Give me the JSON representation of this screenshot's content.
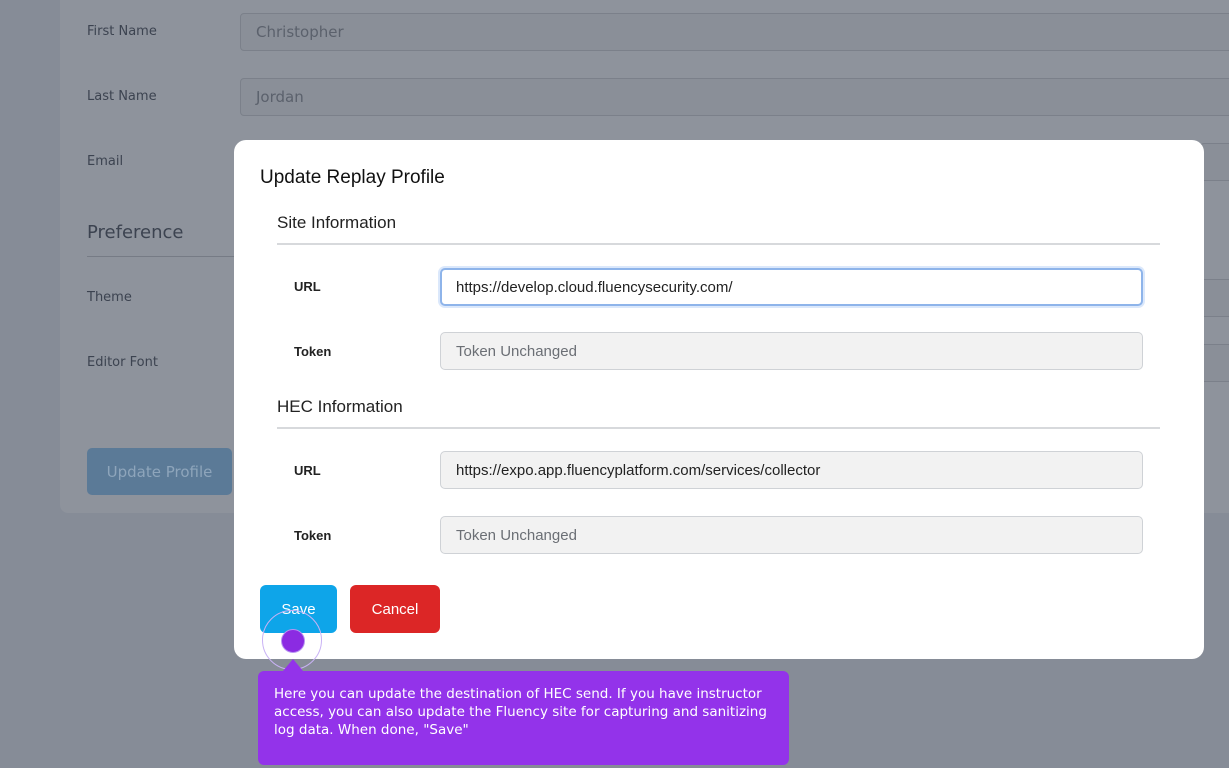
{
  "background_page": {
    "first_name_label": "First Name",
    "first_name_value": "Christopher",
    "last_name_label": "Last Name",
    "last_name_value": "Jordan",
    "email_label": "Email",
    "preference_heading": "Preference",
    "theme_label": "Theme",
    "editor_font_label": "Editor Font",
    "update_profile_button": "Update Profile"
  },
  "modal": {
    "title": "Update Replay Profile",
    "site_section": {
      "title": "Site Information",
      "url_label": "URL",
      "url_value": "https://develop.cloud.fluencysecurity.com/",
      "token_label": "Token",
      "token_placeholder": "Token Unchanged"
    },
    "hec_section": {
      "title": "HEC Information",
      "url_label": "URL",
      "url_value": "https://expo.app.fluencyplatform.com/services/collector",
      "token_label": "Token",
      "token_placeholder": "Token Unchanged"
    },
    "save_label": "Save",
    "cancel_label": "Cancel"
  },
  "tooltip": {
    "text": "Here you can update the destination of HEC send. If you have instructor access, you can also update the Fluency site for capturing and sanitizing log data. When done, \"Save\""
  },
  "colors": {
    "save_button": "#0ea5e9",
    "cancel_button": "#dc2626",
    "tooltip": "#9333ea",
    "overlay": "#868c97"
  }
}
